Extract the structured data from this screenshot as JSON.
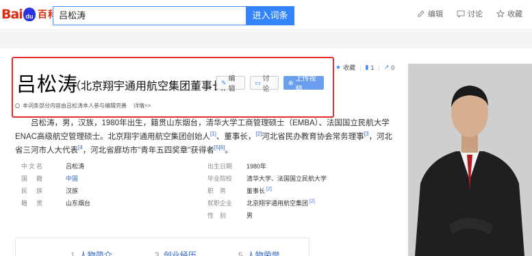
{
  "logo": {
    "text_left": "Bai",
    "paw": "du",
    "baike": "百科"
  },
  "search": {
    "value": "吕松涛",
    "button": "进入词条"
  },
  "top_actions": [
    {
      "label": "编辑",
      "icon": "edit-icon"
    },
    {
      "label": "讨论",
      "icon": "discussion-icon"
    },
    {
      "label": "收藏",
      "icon": "star-icon"
    }
  ],
  "title": {
    "main": "吕松涛",
    "sub": "（北京翔宇通用航空集团董事长）"
  },
  "title_buttons": {
    "edit": "编辑",
    "discuss": "讨论",
    "upload": "上传视频"
  },
  "side_actions": {
    "collect": "收藏",
    "like_count": "1",
    "share_count": "0"
  },
  "notice": {
    "text": "本词条部分内容由吕松涛本人参与编辑完善",
    "link": "详情>>"
  },
  "summary": {
    "text1": "吕松涛，男，汉族，1980年出生，籍贯山东烟台，清华大学工商管理硕士（EMBA）、法国国立民航大学ENAC高级航空管理硕士。北京翔宇通用航空集团创始人",
    "ref1": "[1]",
    "text2": "、董事长，",
    "ref2": "[2]",
    "text3": "河北省民办教育协会常务理事",
    "ref3": "[3",
    "text4": "，河北省三河市人大代表",
    "ref4": "[4",
    "text5": "，河北省廊坊市\"青年五四奖章\"获得者",
    "ref5": "[5",
    "ref6": "[6]",
    "end": "。"
  },
  "info": {
    "left": [
      {
        "label": "中文名",
        "value": "吕松涛",
        "link": false
      },
      {
        "label": "国　籍",
        "value": "中国",
        "link": true
      },
      {
        "label": "民　族",
        "value": "汉族",
        "link": false
      },
      {
        "label": "籍　贯",
        "value": "山东烟台",
        "link": false
      }
    ],
    "right": [
      {
        "label": "出生日期",
        "value": "1980年",
        "ref": ""
      },
      {
        "label": "毕业院校",
        "value": "清华大学、法国国立民航大学",
        "ref": ""
      },
      {
        "label": "职　务",
        "value": "董事长",
        "ref": "[2]"
      },
      {
        "label": "就职企业",
        "value": "北京翔宇通用航空集团",
        "ref": "[2]"
      },
      {
        "label": "性　别",
        "value": "男",
        "ref": ""
      }
    ]
  },
  "toc": [
    {
      "num": "1",
      "label": "人物简介"
    },
    {
      "num": "3",
      "label": "创业经历"
    },
    {
      "num": "5",
      "label": "人物荣誉"
    }
  ],
  "colors": {
    "accent": "#3385ff",
    "brand_red": "#de2910",
    "highlight_border": "#e52b2b",
    "link": "#3366cc"
  }
}
